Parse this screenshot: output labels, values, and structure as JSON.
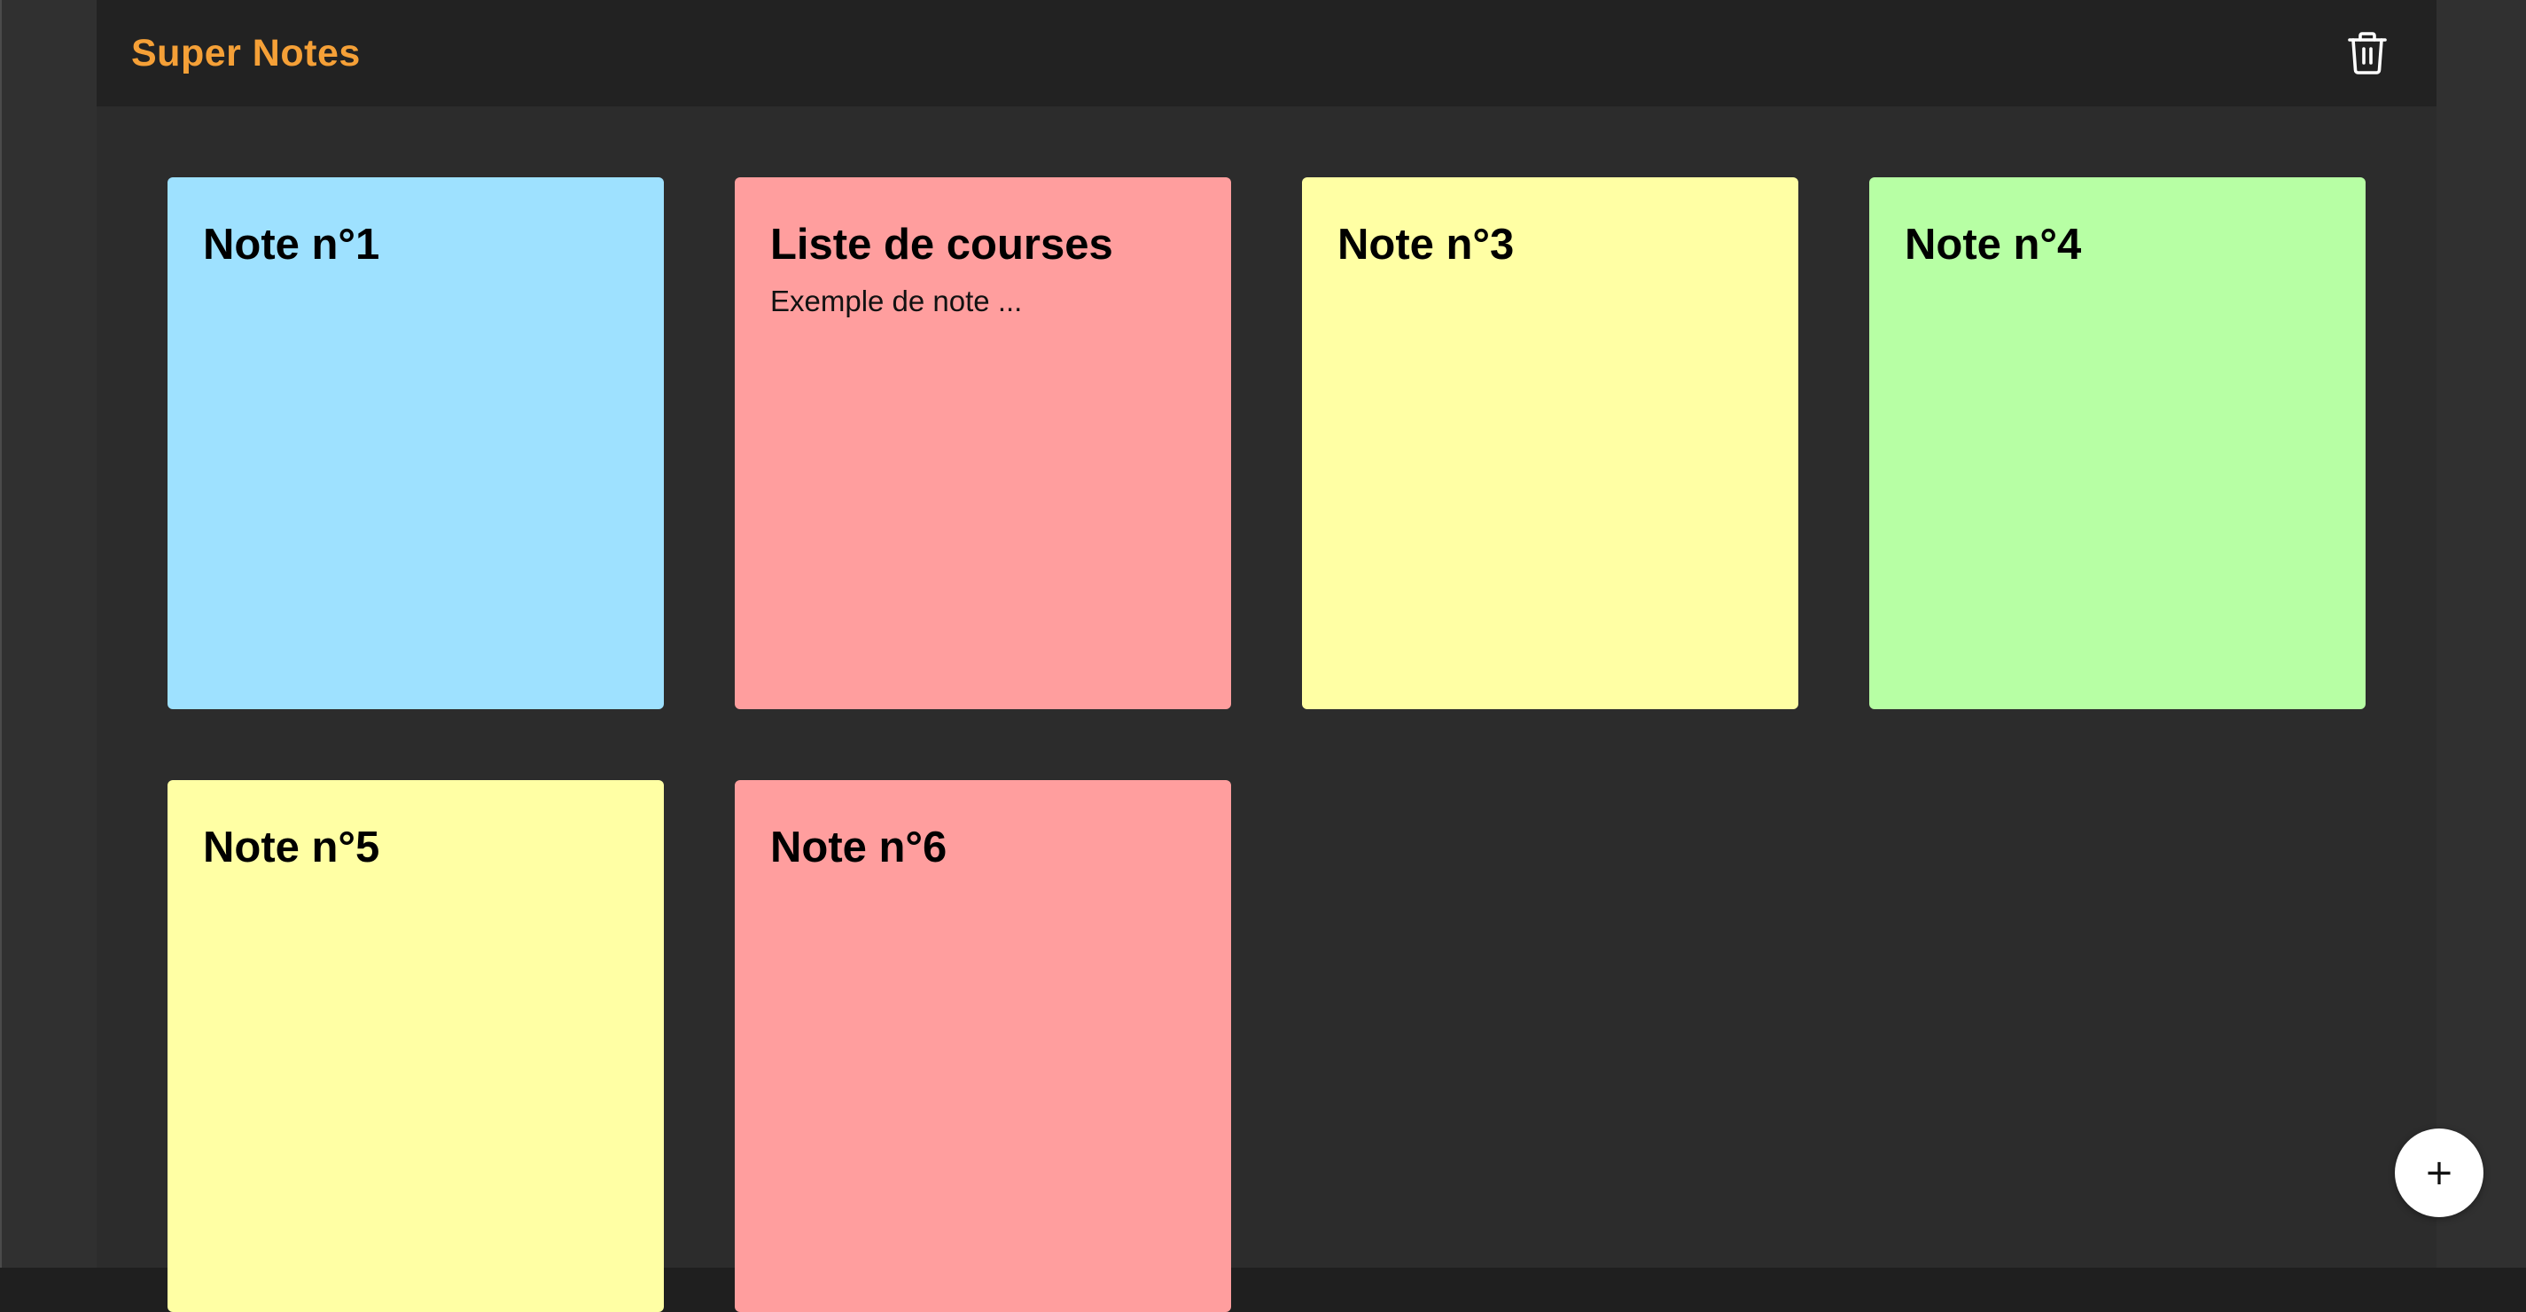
{
  "app": {
    "title": "Super Notes",
    "title_color": "#f5a037",
    "trash_icon": "trash-icon",
    "add_button": {
      "label": "+",
      "icon": "plus-icon"
    }
  },
  "notes": [
    {
      "title": "Note n°1",
      "body": "",
      "color": "#9ee1ff"
    },
    {
      "title": "Liste de courses",
      "body": "Exemple de note ...",
      "color": "#ff9e9e"
    },
    {
      "title": "Note n°3",
      "body": "",
      "color": "#ffffa4"
    },
    {
      "title": "Note n°4",
      "body": "",
      "color": "#b7ffa4"
    },
    {
      "title": "Note n°5",
      "body": "",
      "color": "#ffffa4"
    },
    {
      "title": "Note n°6",
      "body": "",
      "color": "#ff9e9e"
    }
  ]
}
